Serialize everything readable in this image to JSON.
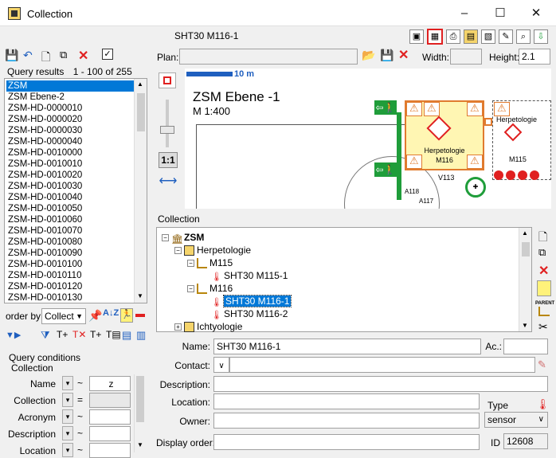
{
  "window": {
    "title": "Collection",
    "minimize": "–",
    "maximize": "☐",
    "close": "✕"
  },
  "header": {
    "selected_name": "SHT30 M116-1"
  },
  "left_toolbar": {
    "icons": [
      "save-icon",
      "undo-icon",
      "new-icon",
      "copy-icon",
      "delete-icon",
      "check-icon"
    ]
  },
  "query_results": {
    "label": "Query results",
    "range": "1 - 100 of 255",
    "items": [
      "ZSM",
      "ZSM Ebene-2",
      "ZSM-HD-0000010",
      "ZSM-HD-0000020",
      "ZSM-HD-0000030",
      "ZSM-HD-0000040",
      "ZSM-HD-0010000",
      "ZSM-HD-0010010",
      "ZSM-HD-0010020",
      "ZSM-HD-0010030",
      "ZSM-HD-0010040",
      "ZSM-HD-0010050",
      "ZSM-HD-0010060",
      "ZSM-HD-0010070",
      "ZSM-HD-0010080",
      "ZSM-HD-0010090",
      "ZSM-HD-0010100",
      "ZSM-HD-0010110",
      "ZSM-HD-0010120",
      "ZSM-HD-0010130"
    ],
    "selected_index": 0
  },
  "order": {
    "label": "order by:",
    "value": "Collect"
  },
  "query_conditions": {
    "label": "Query conditions",
    "group": "Collection",
    "rows": [
      {
        "label": "Name",
        "op": "~",
        "value": "z"
      },
      {
        "label": "Collection",
        "op": "=",
        "value": ""
      },
      {
        "label": "Acronym",
        "op": "~",
        "value": ""
      },
      {
        "label": "Description",
        "op": "~",
        "value": ""
      },
      {
        "label": "Location",
        "op": "~",
        "value": ""
      }
    ]
  },
  "plan": {
    "label": "Plan:",
    "value": "",
    "width_label": "Width:",
    "width_value": "",
    "height_label": "Height:",
    "height_value": "2.1"
  },
  "map": {
    "scale_label": "10 m",
    "title": "ZSM Ebene -1",
    "scale": "M 1:400",
    "room_herpetologie": "Herpetologie",
    "room_m116": "M116",
    "room_v113": "V113",
    "room_m115": "M115",
    "room_a118": "A118",
    "room_a117": "A117",
    "zoom_label": "1:1"
  },
  "collection": {
    "label": "Collection",
    "tree": {
      "root": "ZSM",
      "child1": "Herpetologie",
      "m115": "M115",
      "m115_sensor": "SHT30 M115-1",
      "m116": "M116",
      "m116_sensor1": "SHT30 M116-1",
      "m116_sensor2": "SHT30 M116-2",
      "child2": "Ichtyologie"
    },
    "side_buttons": [
      "new-icon",
      "copy-icon",
      "delete-icon",
      "label-icon",
      "set-parent-icon",
      "cut-icon"
    ],
    "parent_label": "PARENT"
  },
  "form": {
    "name_label": "Name:",
    "name_value": "SHT30 M116-1",
    "acronym_label": "Ac.:",
    "acronym_value": "",
    "contact_label": "Contact:",
    "contact_value": "",
    "description_label": "Description:",
    "description_value": "",
    "location_label": "Location:",
    "location_value": "",
    "type_label": "Type",
    "owner_label": "Owner:",
    "owner_value": "",
    "type_value": "sensor",
    "display_order_label": "Display order:",
    "display_order_value": "",
    "id_label": "ID",
    "id_value": "12608"
  },
  "colors": {
    "accent": "#0078d7",
    "danger": "#e02020",
    "room_yellow": "#fff6b3",
    "exit_green": "#1f9d3a"
  }
}
